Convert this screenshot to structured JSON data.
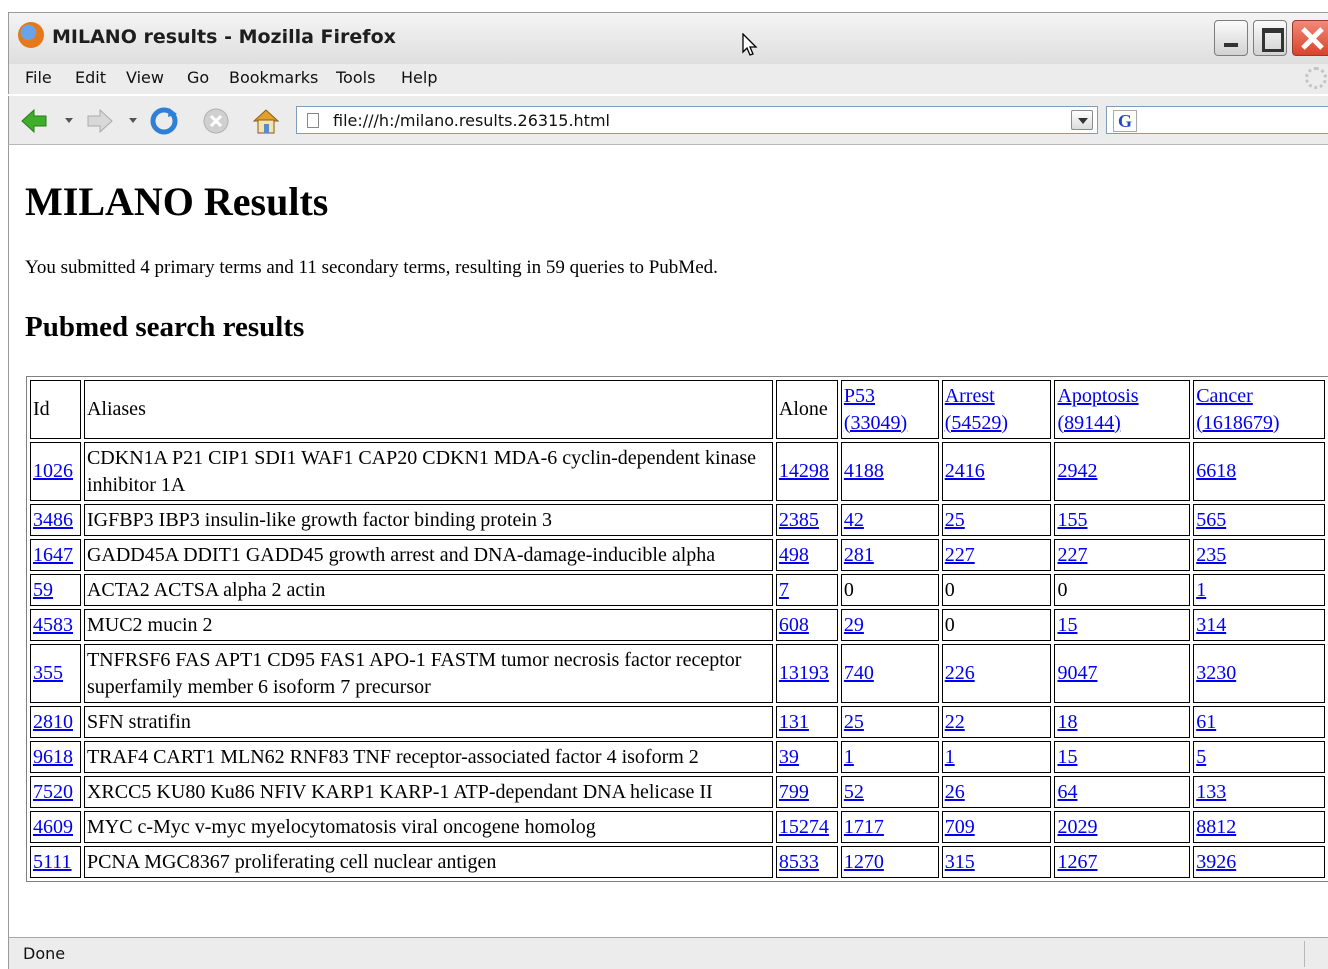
{
  "window": {
    "title": "MILANO results - Mozilla Firefox"
  },
  "menu": [
    "File",
    "Edit",
    "View",
    "Go",
    "Bookmarks",
    "Tools",
    "Help"
  ],
  "toolbar": {
    "url": "file:///h:/milano.results.26315.html",
    "search_placeholder": ""
  },
  "page": {
    "title": "MILANO Results",
    "intro": "You submitted 4 primary terms and 11 secondary terms, resulting in 59 queries to PubMed.",
    "section_title": "Pubmed search results"
  },
  "table": {
    "headers": {
      "id": "Id",
      "aliases": "Aliases",
      "alone": "Alone",
      "p53": [
        "P53",
        "(33049)"
      ],
      "arrest": [
        "Arrest",
        "(54529)"
      ],
      "apoptosis": [
        "Apoptosis",
        "(89144)"
      ],
      "cancer": [
        "Cancer",
        "(1618679)"
      ]
    },
    "rows": [
      {
        "id": "1026",
        "aliases": "CDKN1A P21 CIP1 SDI1 WAF1 CAP20 CDKN1 MDA-6 cyclin-dependent kinase inhibitor 1A",
        "alone": "14298",
        "p53": "4188",
        "arrest": "2416",
        "apoptosis": "2942",
        "cancer": "6618"
      },
      {
        "id": "3486",
        "aliases": "IGFBP3 IBP3 insulin-like growth factor binding protein 3",
        "alone": "2385",
        "p53": "42",
        "arrest": "25",
        "apoptosis": "155",
        "cancer": "565"
      },
      {
        "id": "1647",
        "aliases": "GADD45A DDIT1 GADD45 growth arrest and DNA-damage-inducible alpha",
        "alone": "498",
        "p53": "281",
        "arrest": "227",
        "apoptosis": "227",
        "cancer": "235"
      },
      {
        "id": "59",
        "aliases": "ACTA2 ACTSA alpha 2 actin",
        "alone": "7",
        "p53": "0",
        "arrest": "0",
        "apoptosis": "0",
        "cancer": "1"
      },
      {
        "id": "4583",
        "aliases": "MUC2 mucin 2",
        "alone": "608",
        "p53": "29",
        "arrest": "0",
        "apoptosis": "15",
        "cancer": "314"
      },
      {
        "id": "355",
        "aliases": "TNFRSF6 FAS APT1 CD95 FAS1 APO-1 FASTM tumor necrosis factor receptor superfamily member 6 isoform 7 precursor",
        "alone": "13193",
        "p53": "740",
        "arrest": "226",
        "apoptosis": "9047",
        "cancer": "3230"
      },
      {
        "id": "2810",
        "aliases": "SFN stratifin",
        "alone": "131",
        "p53": "25",
        "arrest": "22",
        "apoptosis": "18",
        "cancer": "61"
      },
      {
        "id": "9618",
        "aliases": "TRAF4 CART1 MLN62 RNF83 TNF receptor-associated factor 4 isoform 2",
        "alone": "39",
        "p53": "1",
        "arrest": "1",
        "apoptosis": "15",
        "cancer": "5"
      },
      {
        "id": "7520",
        "aliases": "XRCC5 KU80 Ku86 NFIV KARP1 KARP-1 ATP-dependant DNA helicase II",
        "alone": "799",
        "p53": "52",
        "arrest": "26",
        "apoptosis": "64",
        "cancer": "133"
      },
      {
        "id": "4609",
        "aliases": "MYC c-Myc v-myc myelocytomatosis viral oncogene homolog",
        "alone": "15274",
        "p53": "1717",
        "arrest": "709",
        "apoptosis": "2029",
        "cancer": "8812"
      },
      {
        "id": "5111",
        "aliases": "PCNA MGC8367 proliferating cell nuclear antigen",
        "alone": "8533",
        "p53": "1270",
        "arrest": "315",
        "apoptosis": "1267",
        "cancer": "3926"
      }
    ]
  },
  "status": {
    "text": "Done"
  },
  "icons": [
    "firefox-icon",
    "back-icon",
    "forward-icon",
    "reload-icon",
    "stop-icon",
    "home-icon",
    "file-icon",
    "google-icon",
    "throbber-icon"
  ],
  "colors": {
    "link": "#0000ee",
    "chrome": "#ececec"
  }
}
